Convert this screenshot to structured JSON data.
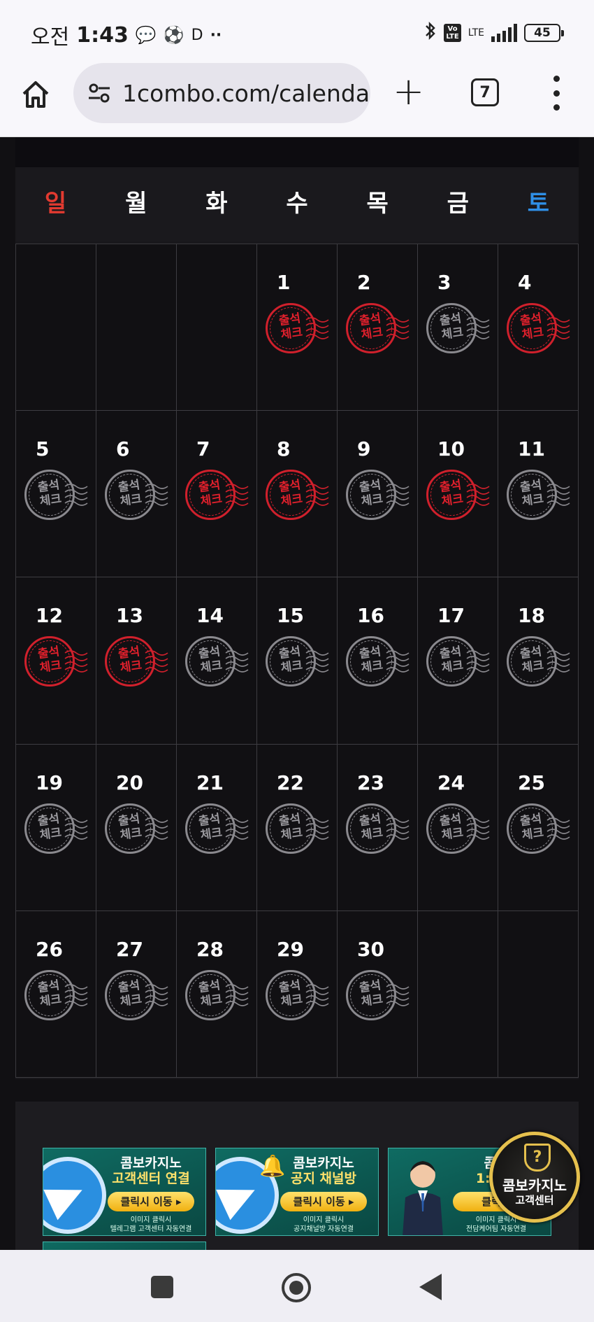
{
  "status": {
    "ampm": "오전",
    "time": "1:43",
    "letter": "D",
    "lte": "LTE",
    "volte": "Vo\nLTE",
    "battery": "45"
  },
  "browser": {
    "url": "1combo.com/calenda",
    "tab_count": "7"
  },
  "calendar": {
    "weekdays": [
      "일",
      "월",
      "화",
      "수",
      "목",
      "금",
      "토"
    ],
    "stamp_text_top": "출석",
    "stamp_text_bottom": "체크",
    "checked_days": [
      1,
      2,
      4,
      7,
      8,
      10,
      12,
      13
    ],
    "days": [
      "",
      "",
      "",
      "1",
      "2",
      "3",
      "4",
      "5",
      "6",
      "7",
      "8",
      "9",
      "10",
      "11",
      "12",
      "13",
      "14",
      "15",
      "16",
      "17",
      "18",
      "19",
      "20",
      "21",
      "22",
      "23",
      "24",
      "25",
      "26",
      "27",
      "28",
      "29",
      "30",
      "",
      ""
    ]
  },
  "banners": [
    {
      "title_line1": "콤보카지노",
      "title_line2": "고객센터 연결",
      "button": "클릭시 이동",
      "caption_line1": "이미지 클릭시",
      "caption_line2": "텔레그램 고객센터 자동연결"
    },
    {
      "title_line1": "콤보카지노",
      "title_line2": "공지 채널방",
      "button": "클릭시 이동",
      "caption_line1": "이미지 클릭시",
      "caption_line2": "공지채널방 자동연결"
    },
    {
      "title_line1": "콤보",
      "title_line2": "1:1 전",
      "button": "클릭시",
      "caption_line1": "이미지 클릭시",
      "caption_line2": "전담케어팀 자동연결"
    }
  ],
  "cs_badge": {
    "line1": "콤보카지노",
    "line2": "고객센터"
  },
  "colors": {
    "sunday": "#e23a30",
    "saturday": "#2f8fe6",
    "stamp_red": "#d0202c",
    "stamp_grey": "#8a898e"
  }
}
